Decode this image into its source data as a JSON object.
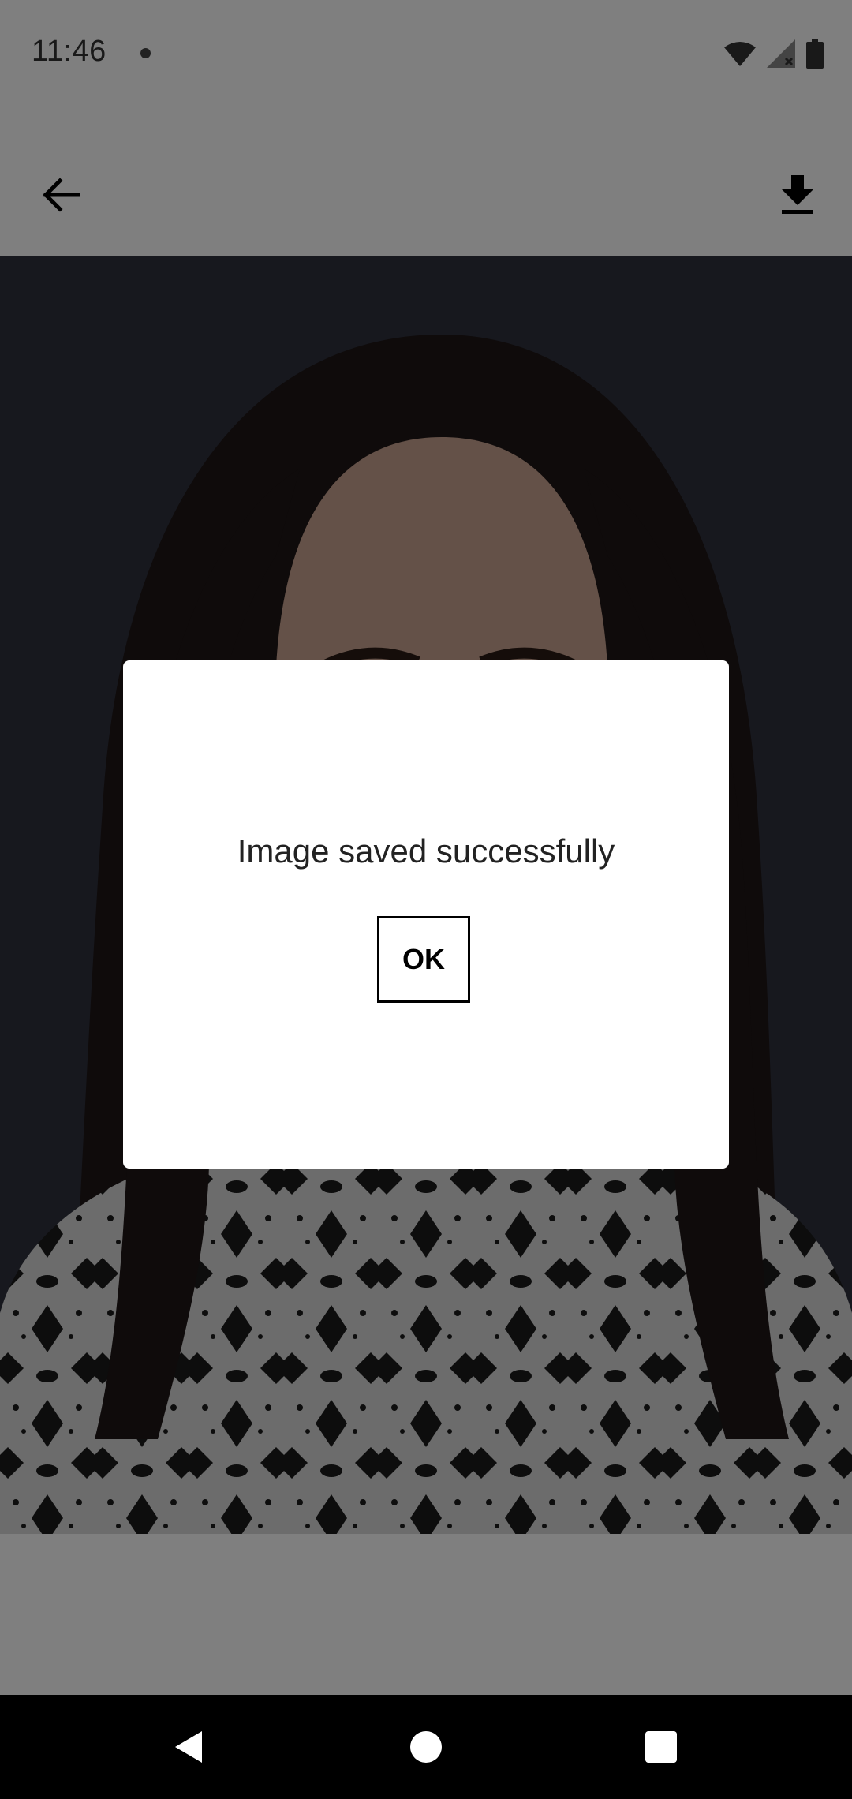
{
  "status_bar": {
    "time": "11:46",
    "icons": [
      "notification-dot-icon",
      "wifi-icon",
      "signal-icon",
      "battery-icon"
    ]
  },
  "app_bar": {
    "back_icon": "arrow-back-icon",
    "download_icon": "download-icon"
  },
  "dialog": {
    "message": "Image saved successfully",
    "ok_label": "OK"
  },
  "nav_bar": {
    "icons": [
      "nav-back-icon",
      "nav-home-icon",
      "nav-recents-icon"
    ]
  },
  "colors": {
    "scrim": "#000000",
    "dialog_bg": "#ffffff",
    "photo_background": "#2b2d38"
  }
}
